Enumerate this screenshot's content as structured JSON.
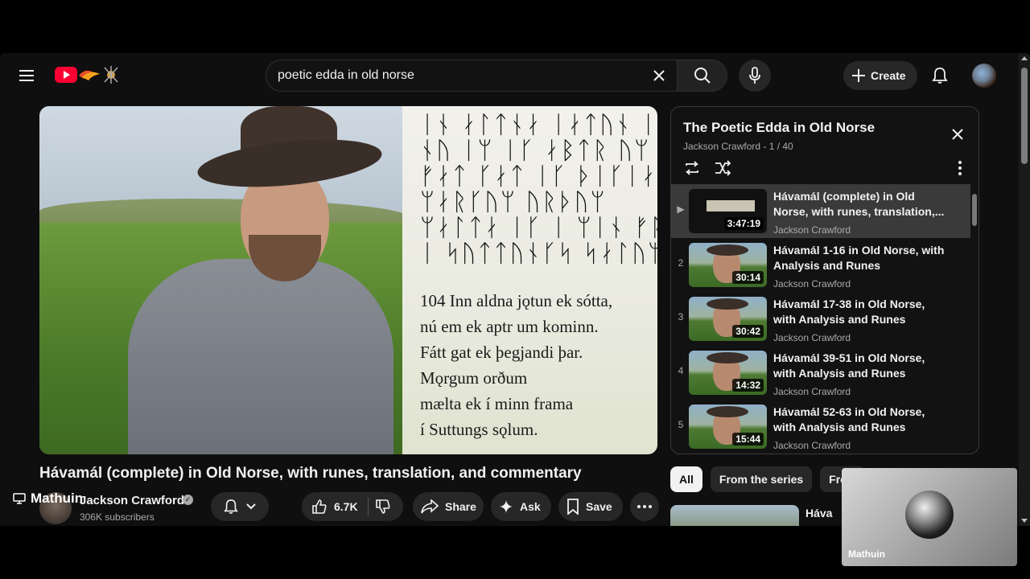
{
  "search": {
    "query": "poetic edda in old norse"
  },
  "header": {
    "create_label": "Create"
  },
  "video": {
    "title": "Hávamál (complete) in Old Norse, with runes, translation, and commentary",
    "channel": "Jackson Crawford",
    "subscribers": "306K subscribers",
    "likes": "6.7K",
    "share_label": "Share",
    "ask_label": "Ask",
    "save_label": "Save",
    "runes": [
      "ᛁᚾ ᛅᛚᛏᚾᛅ ᛁᛅᛏᚢᚾ ᛁᚴ ᛋᚢᛏᛏᛅ",
      "ᚾᚢ ᛁᛘ ᛁᚴ ᛅᛒᛏᚱ ᚢᛘ ᚴᚢᛘᛁᚾ",
      "ᚠᛅᛏ ᚴᛅᛏ ᛁᚴ ᚦᛁᚴᛁᛅᚾᛏᛁ ᚦᛅᚱ",
      "ᛘᛅᚱᚴᚢᛘ ᚢᚱᚦᚢᛘ",
      "ᛘᛅᛚᛏᛅ ᛁᚴ ᛁ ᛘᛁᚾ ᚠᚱᛅᛘᛅ",
      "ᛁ ᛋᚢᛏᛏᚢᚾᚴᛋ ᛋᛅᛚᚢᛘ"
    ],
    "verse": [
      "104 Inn aldna jǫtun ek sótta,",
      "nú em ek aptr um kominn.",
      "Fátt gat ek þegjandi þar.",
      "Mǫrgum orðum",
      "mælta ek í minn frama",
      "í Suttungs sǫlum."
    ]
  },
  "mirror_label": "Mathuin",
  "playlist": {
    "title": "The Poetic Edda in Old Norse",
    "meta": "Jackson Crawford - 1 / 40",
    "items": [
      {
        "index": "▶",
        "title": "Hávamál (complete) in Old Norse, with runes, translation,...",
        "channel": "Jackson Crawford",
        "duration": "3:47:19"
      },
      {
        "index": "2",
        "title": "Hávamál 1-16 in Old Norse, with Analysis and Runes",
        "channel": "Jackson Crawford",
        "duration": "30:14"
      },
      {
        "index": "3",
        "title": "Hávamál 17-38 in Old Norse, with Analysis and Runes",
        "channel": "Jackson Crawford",
        "duration": "30:42"
      },
      {
        "index": "4",
        "title": "Hávamál 39-51 in Old Norse, with Analysis and Runes",
        "channel": "Jackson Crawford",
        "duration": "14:32"
      },
      {
        "index": "5",
        "title": "Hávamál 52-63 in Old Norse, with Analysis and Runes",
        "channel": "Jackson Crawford",
        "duration": "15:44"
      }
    ]
  },
  "chips": [
    "All",
    "From the series",
    "From"
  ],
  "recommended": {
    "title": "Háva"
  },
  "overlay": {
    "name": "Mathuin"
  }
}
